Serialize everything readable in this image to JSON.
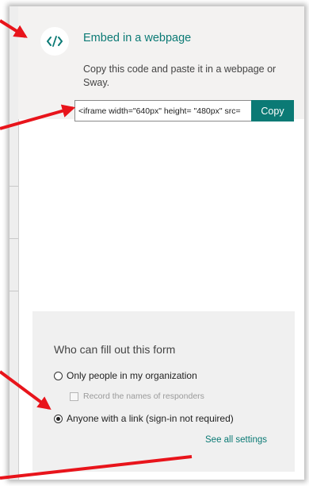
{
  "embed": {
    "icon": "code-brackets-icon",
    "title": "Embed in a webpage",
    "description": "Copy this code and paste it in a webpage or Sway.",
    "code_value": "<iframe width=\"640px\" height= \"480px\" src=",
    "copy_label": "Copy"
  },
  "settings": {
    "heading": "Who can fill out this form",
    "options": [
      {
        "label": "Only people in my organization",
        "selected": false
      },
      {
        "label": "Anyone with a link (sign-in not required)",
        "selected": true
      }
    ],
    "record_names_label": "Record the names of responders",
    "record_names_checked": false,
    "see_all_label": "See all settings"
  },
  "colors": {
    "accent": "#0b7a75",
    "annotation_arrow": "#e8141b",
    "panel_background": "#f3f2f1"
  }
}
